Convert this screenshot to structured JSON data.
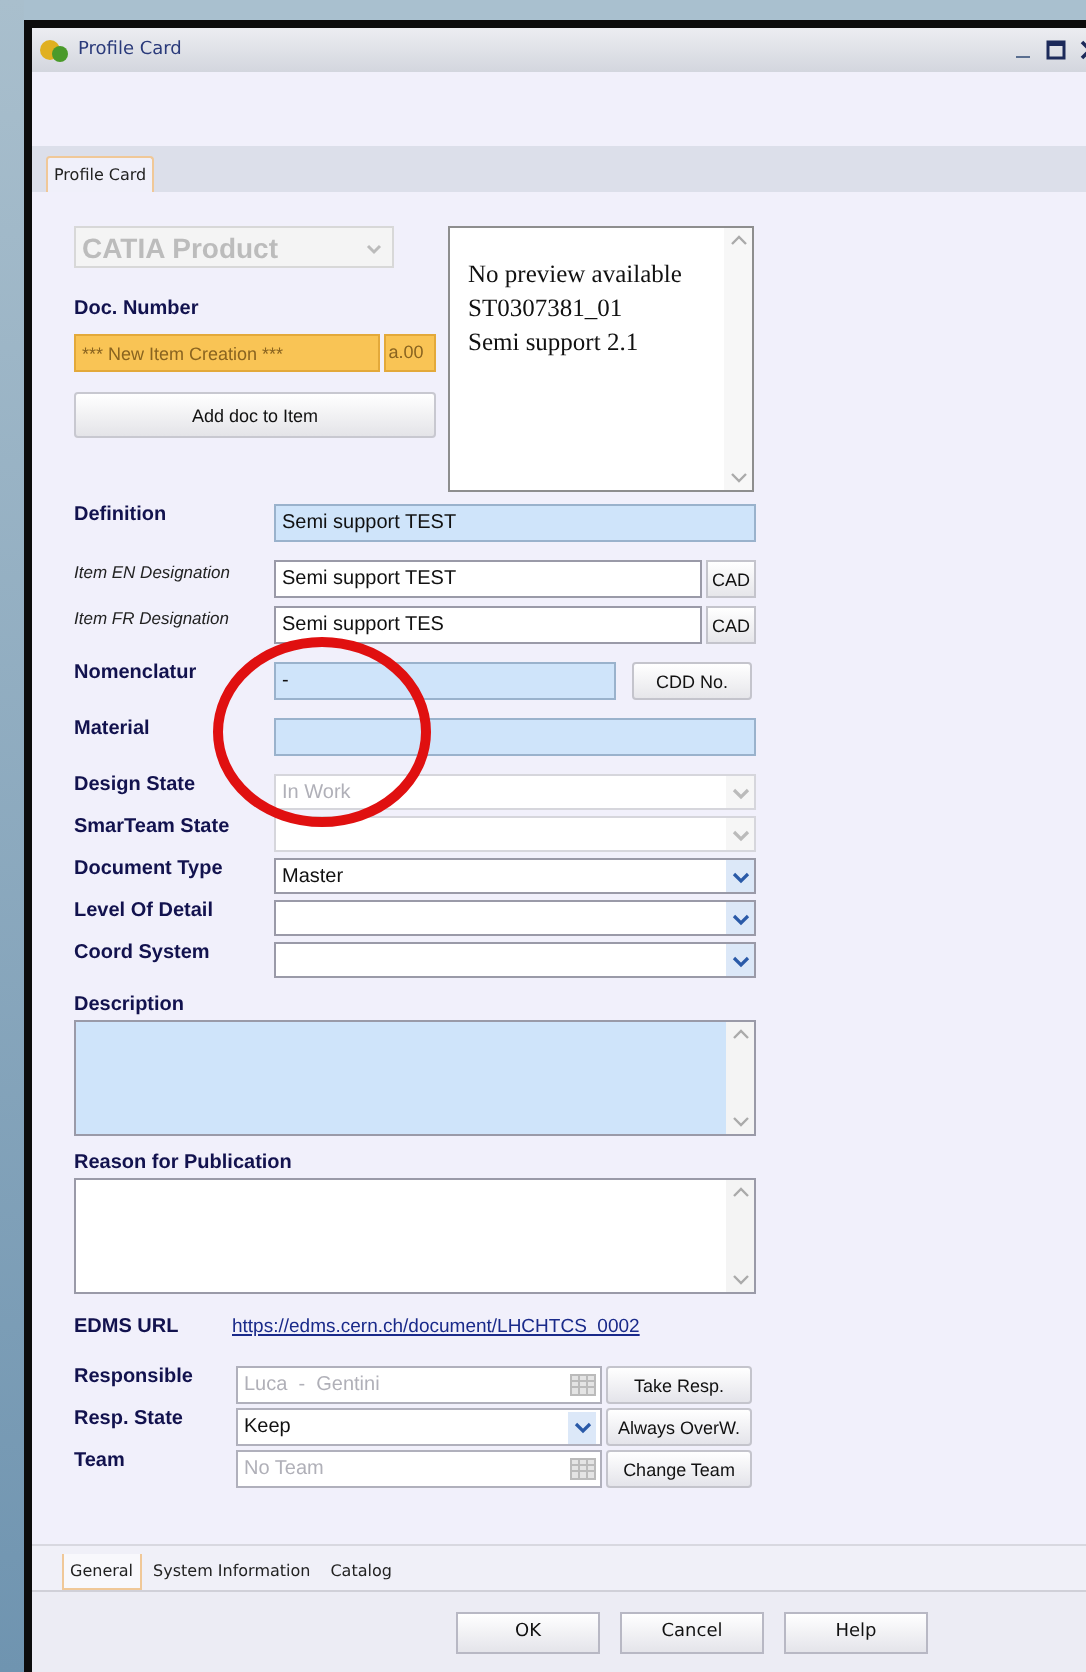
{
  "window": {
    "title": "Profile Card"
  },
  "top_tabs": [
    {
      "label": "Profile Card",
      "selected": true
    }
  ],
  "type_selector": {
    "value": "CATIA Product",
    "disabled": true
  },
  "doc_number": {
    "label": "Doc. Number",
    "placeholder": "*** New Item Creation ***",
    "revision": "a.00"
  },
  "add_button": "Add doc to Item",
  "preview": {
    "lines": [
      "No preview available",
      "ST0307381_01",
      "Semi support 2.1"
    ]
  },
  "fields": [
    {
      "kind": "text",
      "label": "Definition",
      "value": "Semi support TEST",
      "required": true
    },
    {
      "kind": "text_button",
      "label": "Item EN Designation",
      "italic": true,
      "value": "Semi support TEST",
      "button": "CAD"
    },
    {
      "kind": "text_button",
      "label": "Item FR Designation",
      "italic": true,
      "value": "Semi support TES",
      "button": "CAD"
    },
    {
      "kind": "text_short_button",
      "label": "Nomenclatur",
      "value": "-",
      "required": true,
      "button": "CDD No."
    },
    {
      "kind": "text",
      "label": "Material",
      "required": true
    },
    {
      "kind": "select",
      "label": "Design State",
      "value": "In Work",
      "disabled": true
    },
    {
      "kind": "select",
      "label": "SmarTeam State",
      "disabled": true
    },
    {
      "kind": "select",
      "label": "Document Type",
      "value": "Master",
      "disabled": false
    },
    {
      "kind": "select",
      "label": "Level Of Detail",
      "disabled": false
    },
    {
      "kind": "select",
      "label": "Coord System",
      "disabled": false
    },
    {
      "kind": "textarea",
      "label": "Description",
      "required": true
    },
    {
      "kind": "textarea",
      "label": "Reason for Publication",
      "required": false
    },
    {
      "kind": "link",
      "label": "EDMS URL",
      "value": "https://edms.cern.ch/document/LHCHTCS_0002"
    }
  ],
  "assignment": [
    {
      "kind": "picker",
      "label": "Responsible",
      "value": "Luca  -  Gentini",
      "disabled": true,
      "button": "Take Resp."
    },
    {
      "kind": "select",
      "label": "Resp. State",
      "value": "Keep",
      "disabled": false,
      "button": "Always OverW."
    },
    {
      "kind": "picker",
      "label": "Team",
      "value": "No Team",
      "disabled": true,
      "button": "Change Team"
    }
  ],
  "bottom_tabs": [
    {
      "label": "General",
      "selected": true
    },
    {
      "label": "System Information",
      "selected": false
    },
    {
      "label": "Catalog",
      "selected": false
    }
  ],
  "buttons": [
    "OK",
    "Cancel",
    "Help"
  ]
}
